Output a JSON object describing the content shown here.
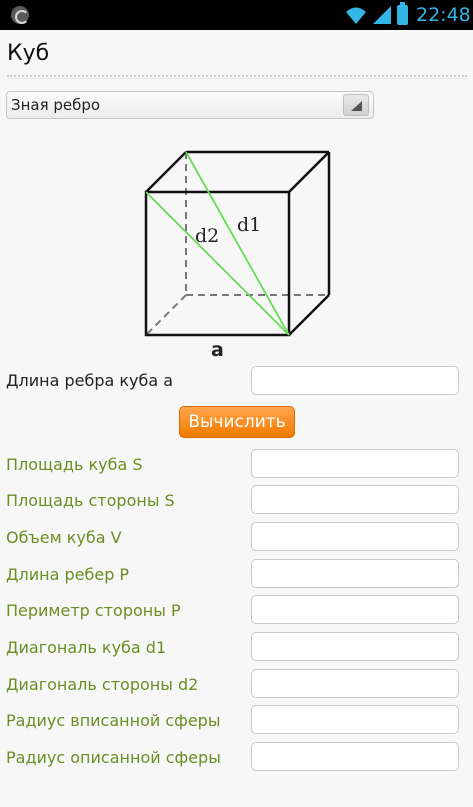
{
  "status_bar": {
    "time": "22:48"
  },
  "app": {
    "title": "Куб"
  },
  "mode_select": {
    "selected": "Зная ребро"
  },
  "diagram": {
    "edge_label": "a",
    "diag_cube_label": "d1",
    "diag_side_label": "d2"
  },
  "input": {
    "edge_label": "Длина ребра куба a",
    "edge_value": ""
  },
  "calculate_label": "Вычислить",
  "results": [
    {
      "label": "Площадь куба S",
      "value": ""
    },
    {
      "label": "Площадь стороны S",
      "value": ""
    },
    {
      "label": "Объем куба V",
      "value": ""
    },
    {
      "label": "Длина ребер P",
      "value": ""
    },
    {
      "label": "Периметр стороны P",
      "value": ""
    },
    {
      "label": "Диагональ куба d1",
      "value": ""
    },
    {
      "label": "Диагональ стороны d2",
      "value": ""
    },
    {
      "label": "Радиус вписанной сферы",
      "value": ""
    },
    {
      "label": "Радиус описанной сферы",
      "value": ""
    }
  ],
  "colors": {
    "accent": "#33b5e5",
    "button": "#f7931e",
    "result_label": "#6b8e23",
    "diagonal": "#66dd55"
  }
}
